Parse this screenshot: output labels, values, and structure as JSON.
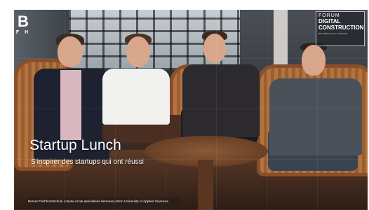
{
  "logo": {
    "letter": "B",
    "subtext": "F H"
  },
  "forum_logo": {
    "line1": "FORUM",
    "line2": "DIGITAL",
    "line3": "CONSTRUCTION",
    "line4": "Bern 2023 | Forum & Netzwerk"
  },
  "hero": {
    "title": "Startup Lunch",
    "subtitle": "S'inspirer des startups qui ont réussi"
  },
  "footer": {
    "text": "Berner Fachhochschule | Haute école spécialisée bernoise | Bern University of Applied Sciences"
  }
}
